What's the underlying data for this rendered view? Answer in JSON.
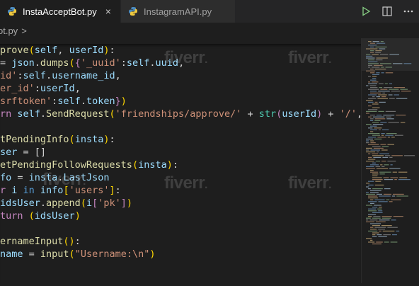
{
  "tabs": [
    {
      "label": "InstaAcceptBot.py",
      "close": "×",
      "active": true
    },
    {
      "label": "InstagramAPI.py",
      "active": false
    }
  ],
  "breadcrumb": {
    "file": "ot.py",
    "separator": ">"
  },
  "actions": {
    "run_icon": "run-icon",
    "split_icon": "split-editor-icon",
    "more_icon": "more-actions-icon"
  },
  "code_lines": [
    [
      [
        "kw",
        ""
      ],
      [
        "fn",
        "prove"
      ],
      [
        "br",
        "("
      ],
      [
        "var",
        "self"
      ],
      [
        "",
        ", "
      ],
      [
        "var",
        "userId"
      ],
      [
        "br",
        ")"
      ],
      [
        "",
        ":"
      ]
    ],
    [
      [
        "",
        "= "
      ],
      [
        "var",
        "json"
      ],
      [
        "",
        "."
      ],
      [
        "fn",
        "dumps"
      ],
      [
        "br",
        "("
      ],
      [
        "ctrl",
        "{"
      ],
      [
        "str",
        "'_uuid'"
      ],
      [
        "",
        ":"
      ],
      [
        "var",
        "self"
      ],
      [
        "",
        "."
      ],
      [
        "var",
        "uuid"
      ],
      [
        "",
        ","
      ]
    ],
    [
      [
        "str",
        "id'"
      ],
      [
        "",
        ":"
      ],
      [
        "var",
        "self"
      ],
      [
        "",
        "."
      ],
      [
        "var",
        "username_id"
      ],
      [
        "",
        ","
      ]
    ],
    [
      [
        "str",
        "er_id'"
      ],
      [
        "",
        ":"
      ],
      [
        "var",
        "userId"
      ],
      [
        "",
        ","
      ]
    ],
    [
      [
        "str",
        "srftoken'"
      ],
      [
        "",
        ":"
      ],
      [
        "var",
        "self"
      ],
      [
        "",
        "."
      ],
      [
        "var",
        "token"
      ],
      [
        "ctrl",
        "}"
      ],
      [
        "br",
        ")"
      ]
    ],
    [
      [
        "ctrl",
        "rn "
      ],
      [
        "var",
        "self"
      ],
      [
        "",
        "."
      ],
      [
        "fn",
        "SendRequest"
      ],
      [
        "br",
        "("
      ],
      [
        "str",
        "'friendships/approve/'"
      ],
      [
        "",
        " + "
      ],
      [
        "cls",
        "str"
      ],
      [
        "ctrl",
        "("
      ],
      [
        "var",
        "userId"
      ],
      [
        "ctrl",
        ")"
      ],
      [
        "",
        " + "
      ],
      [
        "str",
        "'/'"
      ],
      [
        "",
        ", "
      ],
      [
        "var",
        "se"
      ]
    ],
    [],
    [
      [
        "fn",
        "tPendingInfo"
      ],
      [
        "br",
        "("
      ],
      [
        "var",
        "insta"
      ],
      [
        "br",
        ")"
      ],
      [
        "",
        ":"
      ]
    ],
    [
      [
        "var",
        "ser"
      ],
      [
        "",
        " = []"
      ]
    ],
    [
      [
        "fn",
        "etPendingFollowRequests"
      ],
      [
        "br",
        "("
      ],
      [
        "var",
        "insta"
      ],
      [
        "br",
        ")"
      ],
      [
        "",
        ":"
      ]
    ],
    [
      [
        "var",
        "fo"
      ],
      [
        "",
        " = "
      ],
      [
        "var",
        "insta"
      ],
      [
        "",
        "."
      ],
      [
        "var",
        "LastJson"
      ]
    ],
    [
      [
        "ctrl",
        "r "
      ],
      [
        "var",
        "i"
      ],
      [
        "kw",
        " in "
      ],
      [
        "var",
        "info"
      ],
      [
        "br",
        "["
      ],
      [
        "str",
        "'users'"
      ],
      [
        "br",
        "]"
      ],
      [
        "",
        ":"
      ]
    ],
    [
      [
        "var",
        "idsUser"
      ],
      [
        "",
        "."
      ],
      [
        "fn",
        "append"
      ],
      [
        "br",
        "("
      ],
      [
        "var",
        "i"
      ],
      [
        "ctrl",
        "["
      ],
      [
        "str",
        "'pk'"
      ],
      [
        "ctrl",
        "]"
      ],
      [
        "br",
        ")"
      ]
    ],
    [
      [
        "ctrl",
        "turn "
      ],
      [
        "br",
        "("
      ],
      [
        "var",
        "idsUser"
      ],
      [
        "br",
        ")"
      ]
    ],
    [],
    [
      [
        "fn",
        "ernameInput"
      ],
      [
        "br",
        "()"
      ],
      [
        "",
        ":"
      ]
    ],
    [
      [
        "var",
        "name"
      ],
      [
        "",
        " = "
      ],
      [
        "fn",
        "input"
      ],
      [
        "br",
        "("
      ],
      [
        "str",
        "\"Username:\\n\""
      ],
      [
        "br",
        ")"
      ]
    ]
  ],
  "watermark": {
    "text": "fiverr",
    "dot": "."
  }
}
